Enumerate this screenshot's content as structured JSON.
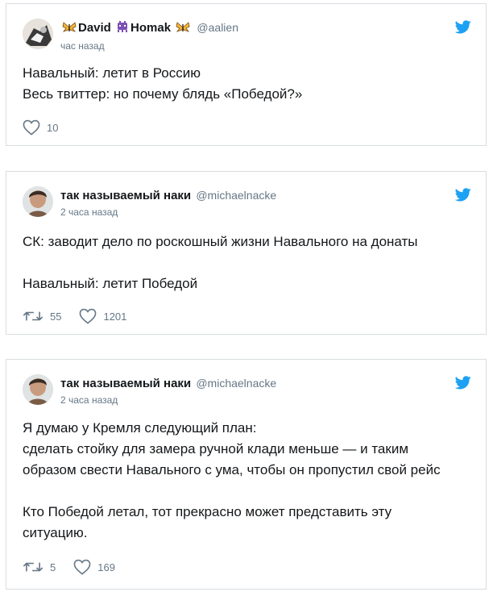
{
  "tweets": [
    {
      "name_part1": "David",
      "name_part2": "Homak",
      "handle": "@aalien",
      "time": "час назад",
      "lines": [
        "Навальный: летит в Россию",
        "Весь твиттер: но почему блядь «Победой?»"
      ],
      "likes": "10"
    },
    {
      "name": "так называемый наки",
      "handle": "@michaelnacke",
      "time": "2 часа назад",
      "lines": [
        "СК: заводит дело по роскошный жизни Навального на донаты",
        "",
        "Навальный: летит Победой"
      ],
      "retweets": "55",
      "likes": "1201"
    },
    {
      "name": "так называемый наки",
      "handle": "@michaelnacke",
      "time": "2 часа назад",
      "lines": [
        "Я думаю у Кремля следующий план:",
        "сделать стойку для замера ручной клади меньше — и таким",
        "образом свести Навального с ума, чтобы он пропустил свой рейс",
        "",
        "Кто Победой летал, тот прекрасно может представить эту",
        "ситуацию."
      ],
      "retweets": "5",
      "likes": "169"
    }
  ],
  "icons": {
    "bird": "twitter-bird-icon",
    "heart": "heart-icon",
    "retweet": "retweet-icon",
    "butterfly": "butterfly-emoji-icon",
    "alien": "alien-monster-emoji-icon"
  },
  "colors": {
    "twitter_blue": "#1da1f2",
    "text": "#14171a",
    "secondary": "#657786",
    "border": "#d8dde1"
  }
}
